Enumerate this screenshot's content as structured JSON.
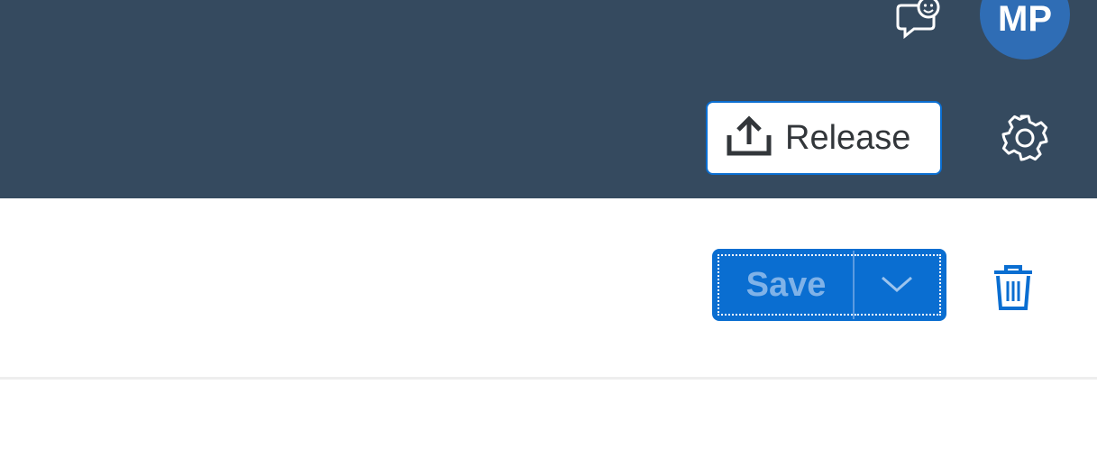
{
  "header": {
    "avatar_initials": "MP",
    "release_label": "Release",
    "feedback_icon": "feedback-icon",
    "settings_icon": "gear-icon",
    "upload_icon": "upload-icon",
    "background_color": "#354a5f"
  },
  "toolbar": {
    "save_label": "Save",
    "save_menu_icon": "chevron-down-icon",
    "delete_icon": "trash-icon",
    "accent_color": "#0a6ed1"
  }
}
